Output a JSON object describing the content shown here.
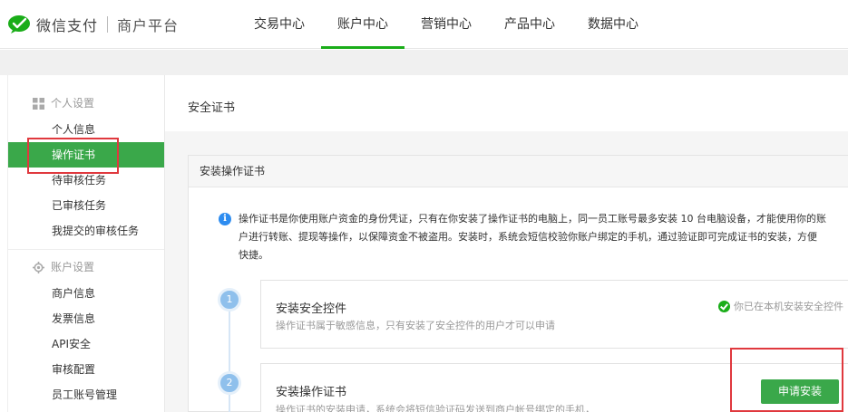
{
  "brand": {
    "name": "微信支付",
    "subtitle": "商户平台",
    "accent": "#1aad19"
  },
  "nav": {
    "items": [
      {
        "label": "交易中心",
        "active": false
      },
      {
        "label": "账户中心",
        "active": true
      },
      {
        "label": "营销中心",
        "active": false
      },
      {
        "label": "产品中心",
        "active": false
      },
      {
        "label": "数据中心",
        "active": false
      }
    ]
  },
  "sidebar": {
    "group1": {
      "label": "个人设置",
      "icon": "grid-icon",
      "items": [
        {
          "label": "个人信息"
        },
        {
          "label": "操作证书",
          "active": true
        },
        {
          "label": "待审核任务"
        },
        {
          "label": "已审核任务"
        },
        {
          "label": "我提交的审核任务"
        }
      ]
    },
    "group2": {
      "label": "账户设置",
      "icon": "gear-icon",
      "items": [
        {
          "label": "商户信息"
        },
        {
          "label": "发票信息"
        },
        {
          "label": "API安全"
        },
        {
          "label": "审核配置"
        },
        {
          "label": "员工账号管理"
        }
      ]
    }
  },
  "main": {
    "title": "安全证书",
    "card": {
      "header": "安装操作证书",
      "info_line1": "操作证书是你使用账户资金的身份凭证，只有在你安装了操作证书的电脑上，同一员工账号最多安装 10 台电脑设备，才能使用你的账",
      "info_line2": "户进行转账、提现等操作，以保障资金不被盗用。安装时，系统会短信校验你账户绑定的手机，通过验证即可完成证书的安装，方便",
      "info_line3": "快捷。",
      "steps": [
        {
          "number": "1",
          "title": "安装安全控件",
          "desc": "操作证书属于敏感信息，只有安装了安全控件的用户才可以申请",
          "status": "你已在本机安装安全控件"
        },
        {
          "number": "2",
          "title": "安装操作证书",
          "desc": "操作证书的安装申请，系统会将短信验证码发送到商户帐号绑定的手机，",
          "button": "申请安装"
        }
      ]
    }
  }
}
